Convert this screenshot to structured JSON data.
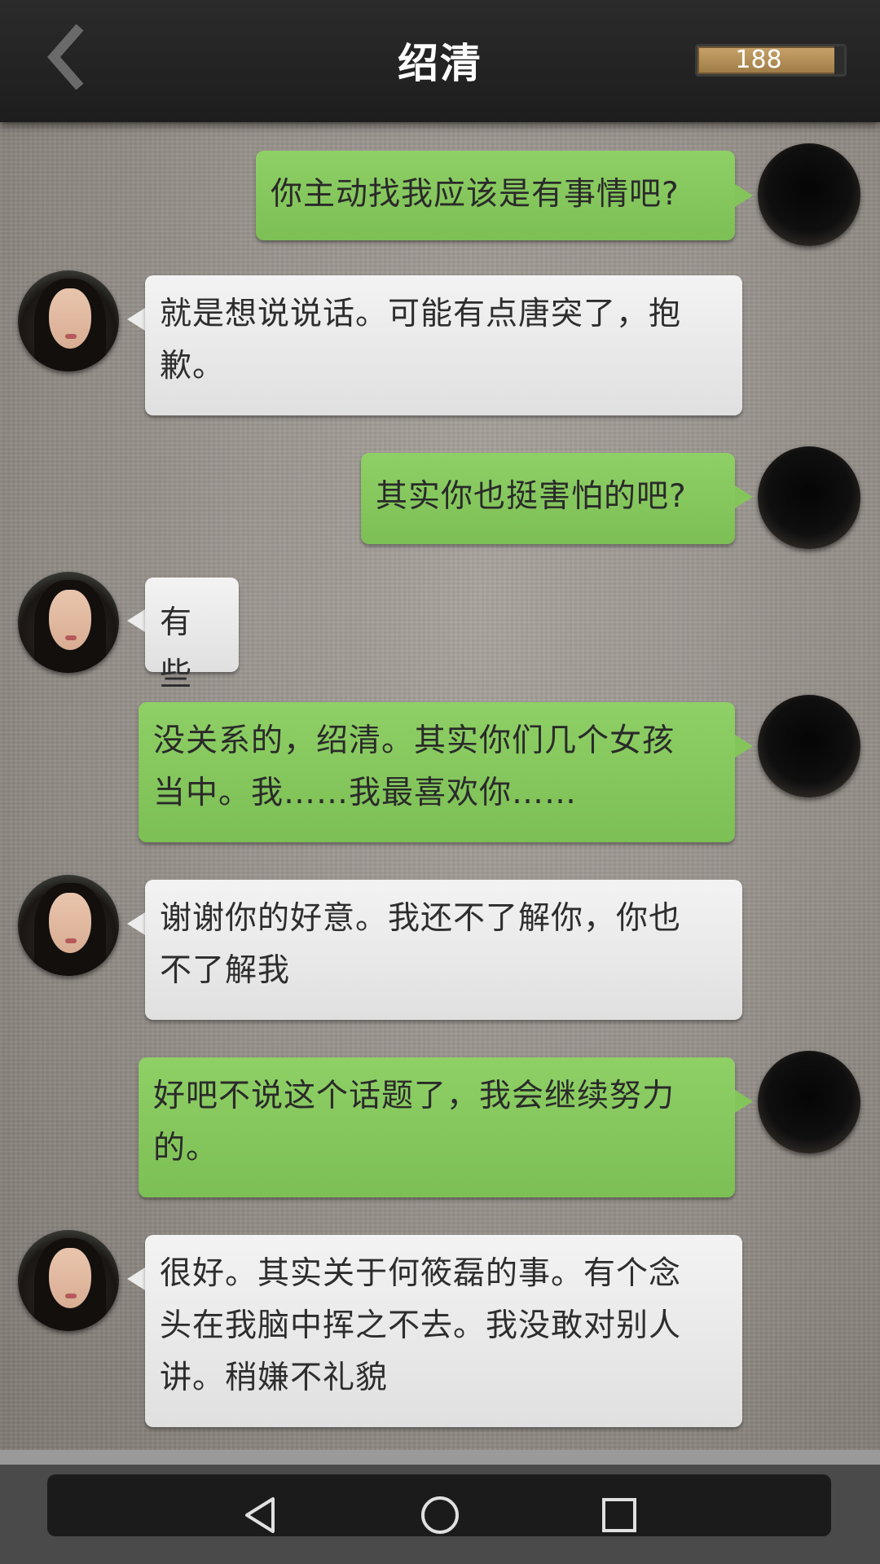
{
  "header": {
    "title": "绍清",
    "coins": "188",
    "back_icon": "chevron-left-icon",
    "coin_icon": "coin-bar-icon"
  },
  "messages": [
    {
      "from": "me",
      "text_lines": [
        "你主动找我应该是有事情吧?"
      ]
    },
    {
      "from": "her",
      "text_lines": [
        "就是想说说话。可能有点唐突了，抱",
        "歉。"
      ]
    },
    {
      "from": "me",
      "text_lines": [
        "其实你也挺害怕的吧?"
      ]
    },
    {
      "from": "her",
      "text_lines": [
        "有些"
      ]
    },
    {
      "from": "me",
      "text_lines": [
        "没关系的，绍清。其实你们几个女孩",
        "当中。我……我最喜欢你……"
      ]
    },
    {
      "from": "her",
      "text_lines": [
        "谢谢你的好意。我还不了解你，你也",
        "不了解我"
      ]
    },
    {
      "from": "me",
      "text_lines": [
        "好吧不说这个话题了，我会继续努力",
        "的。"
      ]
    },
    {
      "from": "her",
      "text_lines": [
        "很好。其实关于何筱磊的事。有个念",
        "头在我脑中挥之不去。我没敢对别人",
        "讲。稍嫌不礼貌"
      ]
    }
  ],
  "navbar": {
    "back_icon": "triangle-back-icon",
    "home_icon": "circle-home-icon",
    "recents_icon": "square-recents-icon"
  },
  "colors": {
    "outgoing_bubble": "#84c55b",
    "incoming_bubble": "#ececec",
    "topbar": "#242424",
    "coin_bar": "#b08e57"
  }
}
